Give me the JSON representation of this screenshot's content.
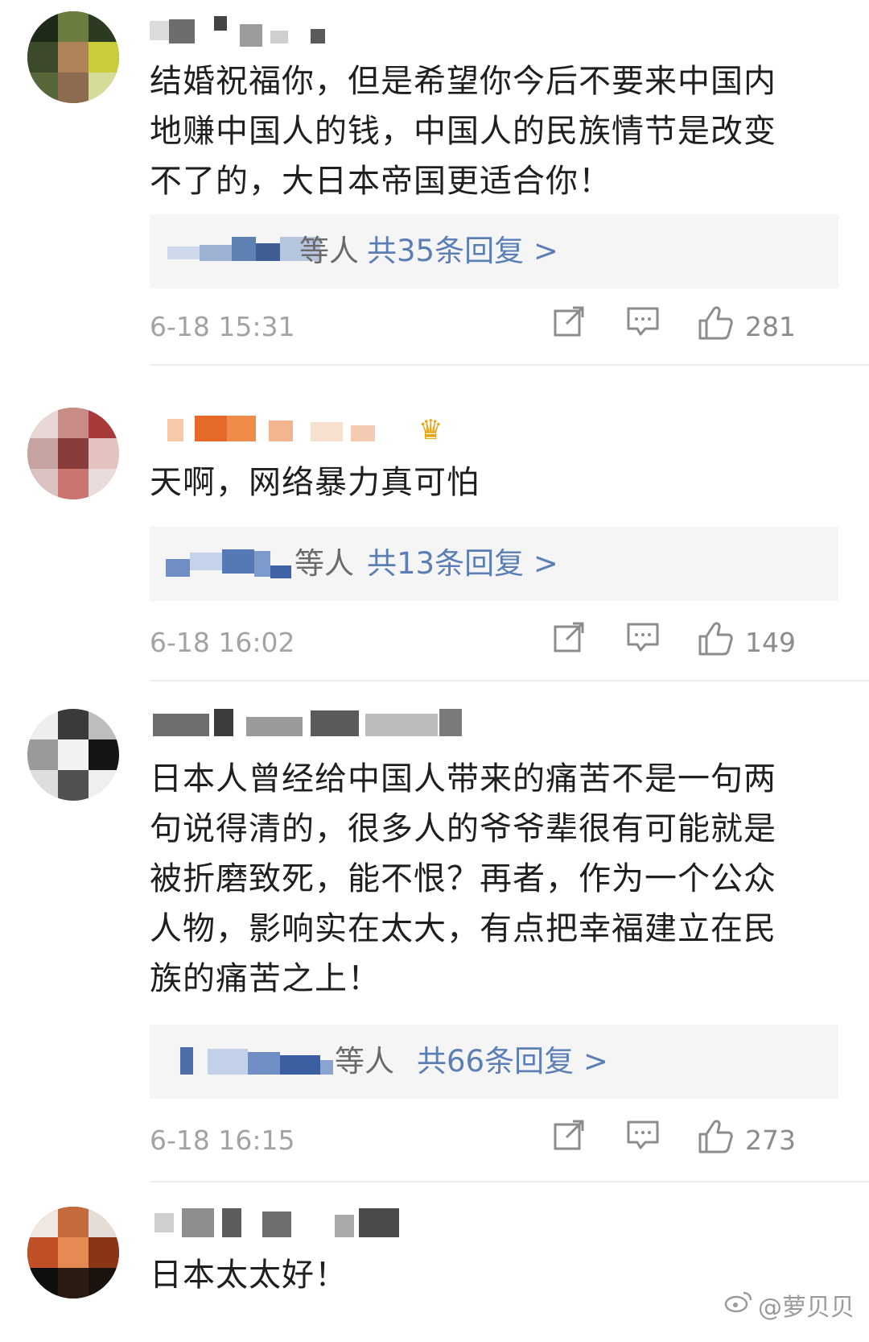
{
  "comments": [
    {
      "text": "结婚祝福你，但是希望你今后不要来中国内\n地赚中国人的钱，中国人的民族情节是改变\n不了的，大日本帝国更适合你！",
      "replies_label": "等人",
      "replies_more": "共35条回复 >",
      "date": "6-18 15:31",
      "likes": "281"
    },
    {
      "text": "天啊，网络暴力真可怕",
      "replies_label": "等人",
      "replies_more": "共13条回复 >",
      "date": "6-18 16:02",
      "likes": "149"
    },
    {
      "text": "日本人曾经给中国人带来的痛苦不是一句两\n句说得清的，很多人的爷爷辈很有可能就是\n被折磨致死，能不恨？再者，作为一个公众\n人物，影响实在太大，有点把幸福建立在民\n族的痛苦之上！",
      "replies_label": "等人",
      "replies_more": "共66条回复 >",
      "date": "6-18 16:15",
      "likes": "273"
    },
    {
      "text": "日本太太好！"
    }
  ],
  "icons": {
    "share": "share-icon",
    "comment": "comment-icon",
    "like": "thumbs-up-icon",
    "crown": "crown-badge-icon",
    "weibo": "weibo-logo-icon"
  },
  "colors": {
    "link": "#5b7fb4",
    "reply_bg": "#f5f5f5",
    "meta": "#a3a3a3"
  },
  "watermark": "@萝贝贝"
}
